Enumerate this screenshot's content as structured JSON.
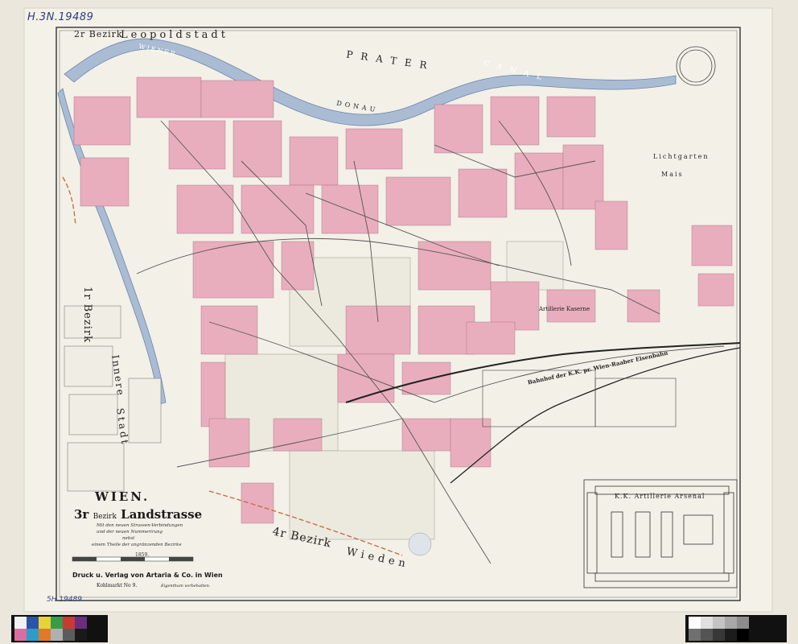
{
  "inventory_note": "H.3N.19489",
  "inventory_note_bottom": "5H 19489",
  "map": {
    "district_2": "2r Bezirk",
    "leopoldstadt": "Leopoldstadt",
    "prater": "PRATER",
    "wiener_neustaedter": "WIENER",
    "donau": "DONAU",
    "canal": "CANAL",
    "lichtgarten": "Lichtgarten",
    "mais": "Mais",
    "district_1": "1r Bezirk",
    "innere": "Innere",
    "stadt": "Stadt",
    "artillerie_kaserne": "Artillerie Kaserne",
    "bahnhof": "Bahnhof der K.K. pr. Wien-Raaber Eisenbahn",
    "district_4": "4r Bezirk",
    "wieden": "Wieden",
    "arsenal": "K.K. Artillerie Arsenal"
  },
  "cartouche": {
    "city": "WIEN.",
    "district_number": "3r",
    "district_word": "Bezirk",
    "district_name": "Landstrasse",
    "sub_line_1": "Mit den neuen Strassen-Verbindungen",
    "sub_line_2": "und der neuen Nummerirung",
    "sub_line_3": "nebst",
    "sub_line_4": "einem Theile der angränzenden Bezirke",
    "year": "1859.",
    "publisher": "Druck u. Verlag von Artaria & Co. in Wien",
    "address": "Kohlmarkt No 9.",
    "rights": "Eigenthum vorbehalten."
  },
  "colorbar_left": [
    "#f2f2f2",
    "#2a55a6",
    "#e8d23a",
    "#3a9a48",
    "#c93a33",
    "#6b2d7e",
    "#d96ea0",
    "#2f9bc8",
    "#e07a2a",
    "#b0b0b0",
    "#5c5c5c",
    "#1a1a1a"
  ],
  "colorbar_right": [
    "#ffffff",
    "#e0e0e0",
    "#c4c4c4",
    "#a8a8a8",
    "#8c8c8c",
    "#707070",
    "#545454",
    "#383838",
    "#1c1c1c",
    "#000000"
  ],
  "colors": {
    "paper": "#f2efe8",
    "buildings": "#e9aebd",
    "water": "#a9bcd4",
    "ink": "#3a3a3a"
  }
}
